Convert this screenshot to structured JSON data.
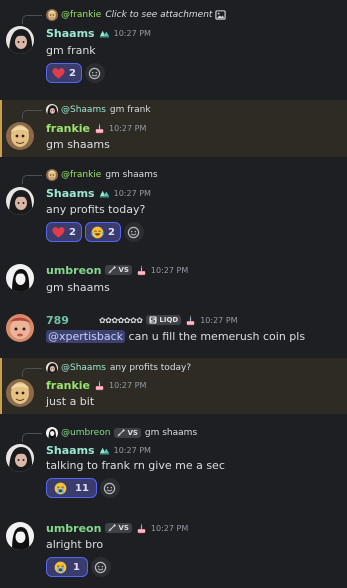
{
  "users": {
    "shaams": {
      "name": "Shaams",
      "color": "#9be7d1"
    },
    "frankie": {
      "name": "frankie",
      "color": "#9be46f"
    },
    "umbreon": {
      "name": "umbreon",
      "color": "#83d98c",
      "tag": "VS"
    },
    "u789": {
      "name": "789",
      "color": "#6fc3a4",
      "deco": "✿✿✿✿✿✿✿",
      "tag": "LIQD"
    }
  },
  "messages": [
    {
      "reply_name": "@frankie",
      "reply_text": "Click to see attachment",
      "author": "Shaams",
      "time": "10:27 PM",
      "text": "gm frank",
      "reactions": [
        {
          "emoji": "heart",
          "count": "2"
        }
      ]
    },
    {
      "reply_name": "@Shaams",
      "reply_text": "gm frank",
      "author": "frankie",
      "time": "10:27 PM",
      "text": "gm shaams"
    },
    {
      "reply_name": "@frankie",
      "reply_text": "gm shaams",
      "author": "Shaams",
      "time": "10:27 PM",
      "text": "any profits today?",
      "reactions": [
        {
          "emoji": "heart",
          "count": "2"
        },
        {
          "emoji": "joy",
          "count": "2"
        }
      ]
    },
    {
      "author": "umbreon",
      "time": "10:27 PM",
      "text": "gm shaams"
    },
    {
      "author": "789",
      "time": "10:27 PM",
      "mention": "@xpertisback",
      "text": " can u fill the memerush coin pls"
    },
    {
      "reply_name": "@Shaams",
      "reply_text": "any profits today?",
      "author": "frankie",
      "time": "10:27 PM",
      "text": "just a bit"
    },
    {
      "reply_name": "@umbreon",
      "reply_tag": "VS",
      "reply_text": "gm shaams",
      "author": "Shaams",
      "time": "10:27 PM",
      "text": "talking to frank rn give me a sec",
      "reactions": [
        {
          "emoji": "sob",
          "count": "11"
        }
      ]
    },
    {
      "author": "umbreon",
      "time": "10:27 PM",
      "text": "alright bro",
      "reactions": [
        {
          "emoji": "sob",
          "count": "1"
        }
      ]
    }
  ],
  "colors": {
    "background": "#1e1f22",
    "highlight": "#2e2a24",
    "reaction_bg": "#3a3c6e",
    "reaction_border": "#5865f2"
  }
}
